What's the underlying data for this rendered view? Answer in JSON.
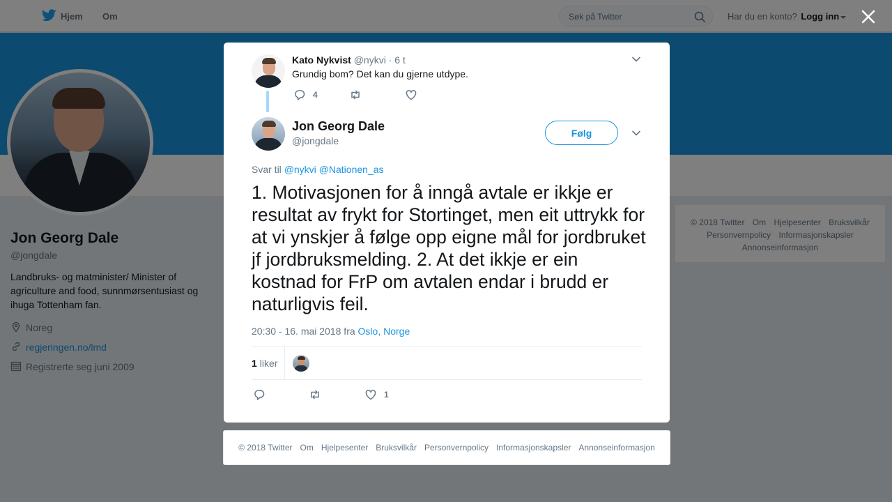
{
  "topnav": {
    "home_label": "Hjem",
    "about_label": "Om",
    "search_placeholder": "Søk på Twitter",
    "account_prompt": "Har du en konto?",
    "login_label": "Logg inn"
  },
  "colors": {
    "brand": "#1b95e0",
    "banner": "#1b95e0",
    "text_secondary": "#657786",
    "overlay": "rgba(0,0,0,0.5)"
  },
  "profile": {
    "name": "Jon Georg Dale",
    "handle": "@jongdale",
    "bio": "Landbruks- og matminister/ Minister of agriculture and food, sunnmørsentusiast og ihuga Tottenham fan.",
    "location": "Noreg",
    "website": "regjeringen.no/lmd",
    "joined": "Registrerte seg juni 2009"
  },
  "footer_links": [
    "© 2018 Twitter",
    "Om",
    "Hjelpesenter",
    "Bruksvilkår",
    "Personvernpolicy",
    "Informasjonskapsler",
    "Annonseinformasjon"
  ],
  "modal": {
    "parent_tweet": {
      "name": "Kato Nykvist",
      "handle": "@nykvi",
      "time": "· 6 t",
      "text": "Grundig bom? Det kan du gjerne utdype.",
      "reply_count": "4",
      "retweet_count": "",
      "like_count": ""
    },
    "main_tweet": {
      "name": "Jon Georg Dale",
      "handle": "@jongdale",
      "follow_label": "Følg",
      "reply_prefix": "Svar til",
      "reply_mentions": [
        "@nykvi",
        "@Nationen_as"
      ],
      "text": "1. Motivasjonen for å inngå avtale er ikkje er resultat av frykt for Stortinget, men eit uttrykk for at vi ynskjer å følge opp eigne mål for jordbruket jf jordbruksmelding. 2. At det ikkje er ein kostnad for FrP om avtalen endar i brudd er naturligvis feil.",
      "timestamp": "20:30 - 16. mai 2018 fra",
      "place": "Oslo, Norge",
      "likes_count": "1",
      "likes_label": "liker",
      "reply_count": "",
      "retweet_count": "",
      "like_count": "1"
    }
  }
}
